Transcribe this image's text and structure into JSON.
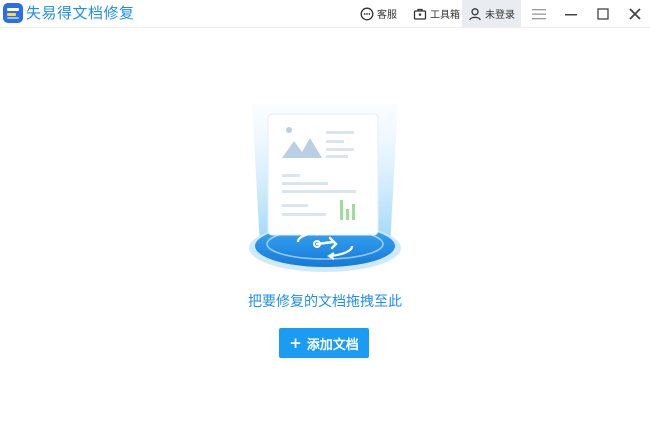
{
  "app": {
    "title": "失易得文档修复",
    "logo_icon": "app-logo-icon",
    "accent_color": "#1e8fee"
  },
  "toolbar": {
    "service_label": "客服",
    "service_icon": "chat-bubble-icon",
    "toolbox_label": "工具箱",
    "toolbox_icon": "toolbox-icon",
    "login_label": "未登录",
    "login_icon": "user-icon"
  },
  "window_controls": {
    "menu_icon": "hamburger-menu-icon",
    "minimize_icon": "minimize-icon",
    "maximize_icon": "maximize-icon",
    "close_icon": "close-icon"
  },
  "main": {
    "illustration_icon": "document-repair-illustration",
    "drop_hint": "把要修复的文档拖拽至此",
    "add_button_plus": "+",
    "add_button_label": "添加文档",
    "button_color": "#1a9bf4"
  }
}
